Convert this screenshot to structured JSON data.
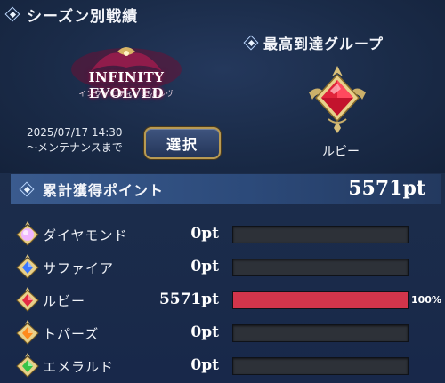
{
  "header": {
    "title": "シーズン別戦績"
  },
  "season": {
    "logo_main": "INFINITY EVOLVED",
    "logo_sub": "インフィニティ・エボルヴ",
    "date_line1": "2025/07/17 14:30",
    "date_line2": "〜メンテナンスまで",
    "select_label": "選択"
  },
  "highest": {
    "title": "最高到達グループ",
    "rank_name": "ルビー",
    "rank_icon": "ruby-emblem-icon"
  },
  "points": {
    "title": "累計獲得ポイント",
    "total": "5571pt",
    "ranks": [
      {
        "label": "ダイヤモンド",
        "pt": "0pt",
        "progress": 0,
        "pct_label": "",
        "icon": "diamond-gem-icon",
        "gem_color": "#f0b6ff"
      },
      {
        "label": "サファイア",
        "pt": "0pt",
        "progress": 0,
        "pct_label": "",
        "icon": "sapphire-gem-icon",
        "gem_color": "#3a78ff"
      },
      {
        "label": "ルビー",
        "pt": "5571pt",
        "progress": 1.0,
        "pct_label": "100%",
        "icon": "ruby-gem-icon",
        "gem_color": "#e42a44"
      },
      {
        "label": "トパーズ",
        "pt": "0pt",
        "progress": 0,
        "pct_label": "",
        "icon": "topaz-gem-icon",
        "gem_color": "#ff8a1c"
      },
      {
        "label": "エメラルド",
        "pt": "0pt",
        "progress": 0,
        "pct_label": "",
        "icon": "emerald-gem-icon",
        "gem_color": "#37c448"
      }
    ]
  },
  "colors": {
    "bar_fill": "#d2354b",
    "accent_gold": "#b89a53"
  }
}
